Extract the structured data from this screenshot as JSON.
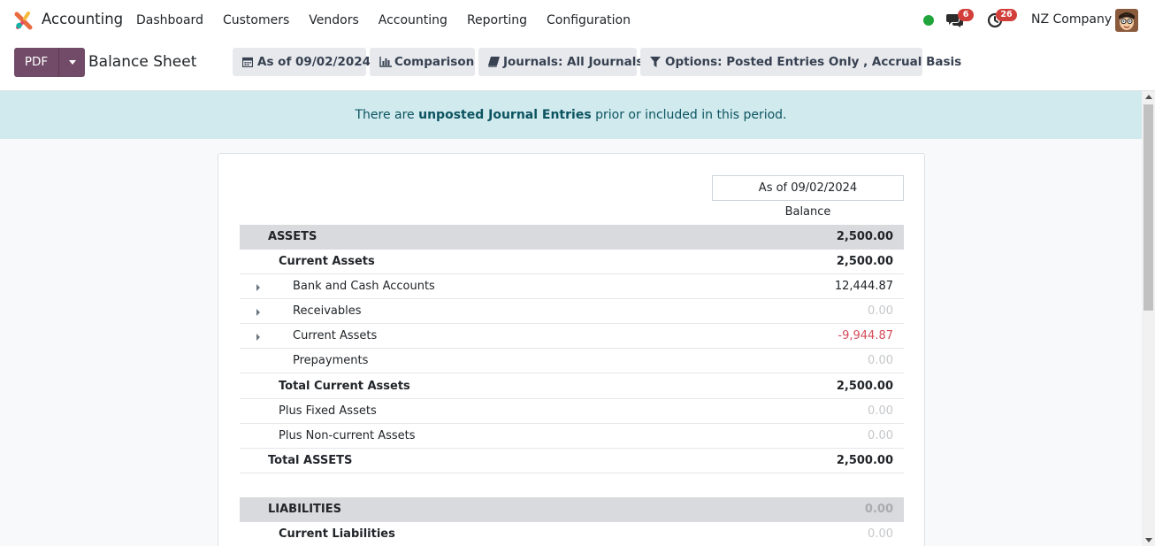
{
  "navbar": {
    "app_name": "Accounting",
    "menu": [
      "Dashboard",
      "Customers",
      "Vendors",
      "Accounting",
      "Reporting",
      "Configuration"
    ],
    "chat_count": "6",
    "activity_count": "26",
    "company": "NZ Company",
    "status_color": "#21a53b"
  },
  "control": {
    "pdf_label": "PDF",
    "title": "Balance Sheet",
    "date_filter": "As of 09/02/2024",
    "comparison": "Comparison",
    "journals": "Journals: All Journals",
    "options": "Options: Posted Entries Only , Accrual Basis"
  },
  "alert": {
    "prefix": "There are ",
    "link": "unposted Journal Entries",
    "suffix": " prior or included in this period."
  },
  "report": {
    "column_header": "As of 09/02/2024",
    "column_sub": "Balance",
    "rows": [
      {
        "label": "ASSETS",
        "value": "2,500.00"
      },
      {
        "label": "Current Assets",
        "value": "2,500.00"
      },
      {
        "label": "Bank and Cash Accounts",
        "value": "12,444.87"
      },
      {
        "label": "Receivables",
        "value": "0.00"
      },
      {
        "label": "Current Assets",
        "value": "-9,944.87"
      },
      {
        "label": "Prepayments",
        "value": "0.00"
      },
      {
        "label": "Total Current Assets",
        "value": "2,500.00"
      },
      {
        "label": "Plus Fixed Assets",
        "value": "0.00"
      },
      {
        "label": "Plus Non-current Assets",
        "value": "0.00"
      },
      {
        "label": "Total ASSETS",
        "value": "2,500.00"
      },
      {
        "label": "LIABILITIES",
        "value": "0.00"
      },
      {
        "label": "Current Liabilities",
        "value": "0.00"
      }
    ]
  },
  "colors": {
    "primary": "#714b67",
    "alert_bg": "#d0eaee",
    "negative": "#d44c59"
  }
}
